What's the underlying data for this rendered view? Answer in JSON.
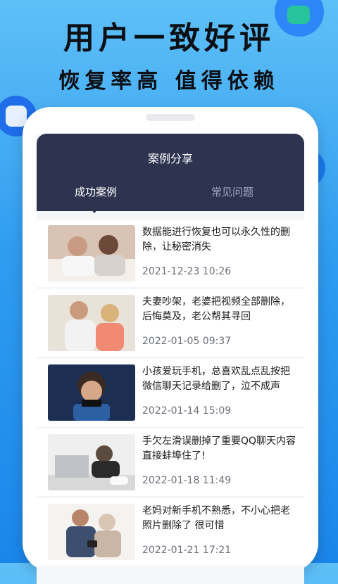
{
  "headline": {
    "line1": "用户一致好评",
    "line2": "恢复率高  值得依赖"
  },
  "decor": {
    "icons": [
      "chat-icon",
      "phone-icon",
      "folder-icon"
    ]
  },
  "app": {
    "title": "案例分享",
    "tabs": [
      {
        "label": "成功案例",
        "active": true
      },
      {
        "label": "常见问题",
        "active": false
      }
    ],
    "cases": [
      {
        "title": "数据能进行恢复也可以永久性的删除，让秘密消失",
        "date": "2021-12-23 10:26",
        "image": "couple-in-bed-photo"
      },
      {
        "title": "夫妻吵架，老婆把视频全部删除，后悔莫及，老公帮其寻回",
        "date": "2022-01-05 09:37",
        "image": "couple-arguing-photo"
      },
      {
        "title": "小孩爱玩手机，总喜欢乱点乱按把微信聊天记录给删了，泣不成声",
        "date": "2022-01-14 15:09",
        "image": "boy-playing-phone-photo"
      },
      {
        "title": "手欠左滑误删掉了重要QQ聊天内容 直接蚌埠住了!",
        "date": "2022-01-18 11:49",
        "image": "stressed-man-laptop-photo"
      },
      {
        "title": "老妈对新手机不熟悉，不小心把老照片删除了 很可惜",
        "date": "2022-01-21 17:21",
        "image": "son-and-mother-photo"
      }
    ]
  },
  "colors": {
    "background": "#2f9cf0",
    "appbar": "#2e3350",
    "tab_inactive": "#a4a9bf",
    "date": "#6b6f7a"
  }
}
